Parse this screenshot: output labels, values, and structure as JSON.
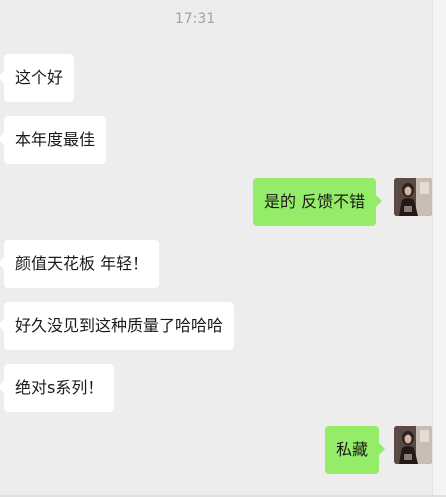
{
  "chat": {
    "timestamp": "17:31",
    "messages": [
      {
        "side": "left",
        "text": "这个好"
      },
      {
        "side": "left",
        "text": "本年度最佳"
      },
      {
        "side": "right",
        "text": "是的 反馈不错"
      },
      {
        "side": "left",
        "text": "颜值天花板 年轻！"
      },
      {
        "side": "left",
        "text": "好久没见到这种质量了哈哈哈"
      },
      {
        "side": "left",
        "text": "绝对s系列！"
      },
      {
        "side": "right",
        "text": "私藏"
      }
    ]
  },
  "colors": {
    "background": "#ededed",
    "incoming_bubble": "#ffffff",
    "outgoing_bubble": "#95ec69",
    "timestamp_text": "#a3a3a3"
  },
  "icons": {
    "self_avatar": "user-photo-avatar"
  }
}
